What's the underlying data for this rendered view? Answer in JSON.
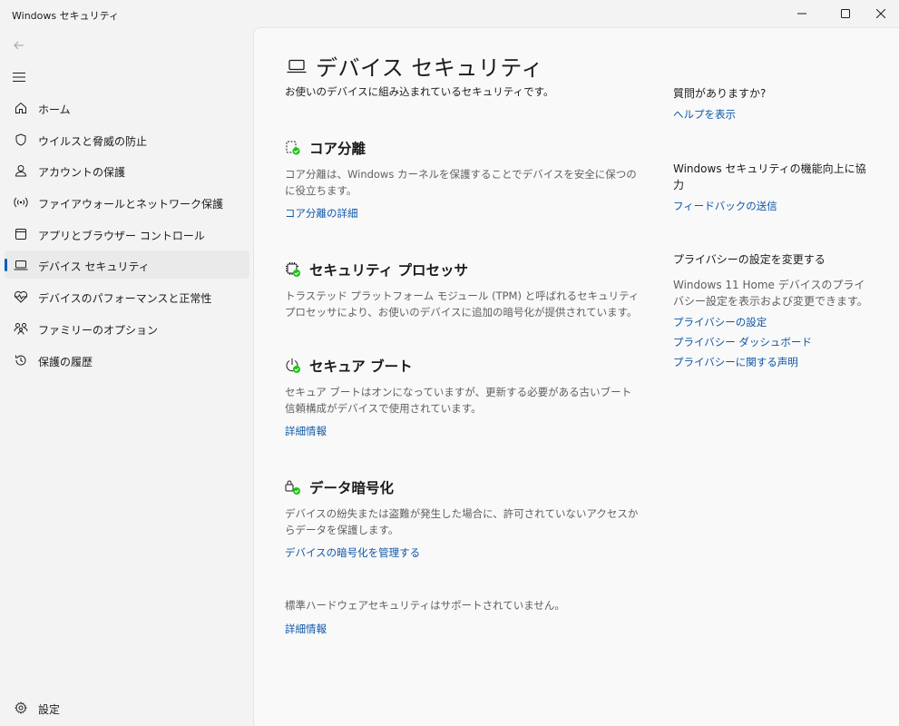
{
  "window": {
    "title": "Windows セキュリティ"
  },
  "sidebar": {
    "items": [
      {
        "label": "ホーム",
        "icon": "home-icon"
      },
      {
        "label": "ウイルスと脅威の防止",
        "icon": "shield-icon"
      },
      {
        "label": "アカウントの保護",
        "icon": "person-icon"
      },
      {
        "label": "ファイアウォールとネットワーク保護",
        "icon": "wireless-icon"
      },
      {
        "label": "アプリとブラウザー コントロール",
        "icon": "app-window-icon"
      },
      {
        "label": "デバイス セキュリティ",
        "icon": "laptop-icon",
        "selected": true
      },
      {
        "label": "デバイスのパフォーマンスと正常性",
        "icon": "heart-pulse-icon"
      },
      {
        "label": "ファミリーのオプション",
        "icon": "family-icon"
      },
      {
        "label": "保護の履歴",
        "icon": "history-icon"
      }
    ],
    "settings_label": "設定"
  },
  "main": {
    "title": "デバイス セキュリティ",
    "description": "お使いのデバイスに組み込まれているセキュリティです。",
    "sections": [
      {
        "title": "コア分離",
        "description": "コア分離は、Windows カーネルを保護することでデバイスを安全に保つのに役立ちます。",
        "link": "コア分離の詳細",
        "icon": "core-isolation-icon"
      },
      {
        "title": "セキュリティ プロセッサ",
        "description": "トラステッド プラットフォーム モジュール (TPM) と呼ばれるセキュリティ プロセッサにより、お使いのデバイスに追加の暗号化が提供されています。",
        "icon": "chip-icon"
      },
      {
        "title": "セキュア ブート",
        "description": "セキュア ブートはオンになっていますが、更新する必要がある古いブート信頼構成がデバイスで使用されています。",
        "link": "詳細情報",
        "icon": "secure-boot-icon"
      },
      {
        "title": "データ暗号化",
        "description": "デバイスの紛失または盗難が発生した場合に、許可されていないアクセスからデータを保護します。",
        "link": "デバイスの暗号化を管理する",
        "icon": "encryption-icon"
      }
    ],
    "hardware_note": "標準ハードウェアセキュリティはサポートされていません。",
    "hardware_link": "詳細情報"
  },
  "aside": {
    "help_heading": "質問がありますか?",
    "help_link": "ヘルプを表示",
    "feedback_heading": "Windows セキュリティの機能向上に協力",
    "feedback_link": "フィードバックの送信",
    "privacy_heading": "プライバシーの設定を変更する",
    "privacy_desc": "Windows 11 Home デバイスのプライバシー設定を表示および変更できます。",
    "privacy_links": [
      "プライバシーの設定",
      "プライバシー ダッシュボード",
      "プライバシーに関する声明"
    ]
  },
  "colors": {
    "accent": "#005fb8",
    "link": "#0f57a8",
    "status_ok": "#16c60c"
  }
}
